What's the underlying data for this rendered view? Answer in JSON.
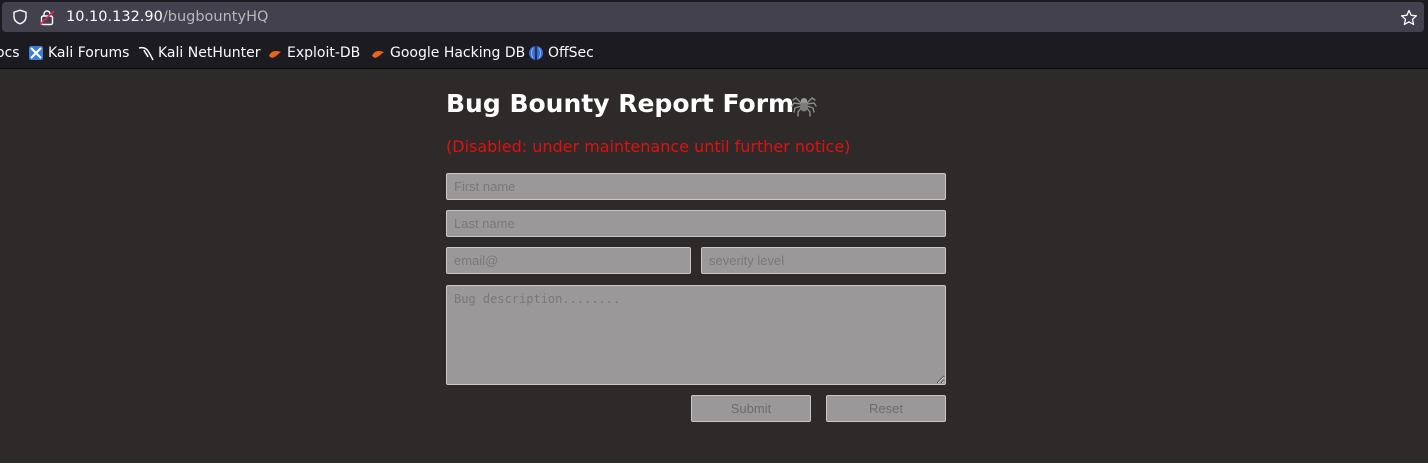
{
  "browser": {
    "url_host": "10.10.132.90",
    "url_path": "/bugbountyHQ",
    "bookmarks": [
      {
        "label": "ocs",
        "icon": "none"
      },
      {
        "label": "Kali Forums",
        "icon": "kali-forums-icon"
      },
      {
        "label": "Kali NetHunter",
        "icon": "kali-dragon-icon"
      },
      {
        "label": "Exploit-DB",
        "icon": "exploit-db-icon"
      },
      {
        "label": "Google Hacking DB",
        "icon": "ghdb-icon"
      },
      {
        "label": "OffSec",
        "icon": "offsec-icon"
      }
    ]
  },
  "page": {
    "title": "Bug Bounty Report Form",
    "title_icon": "spider-icon",
    "notice": "(Disabled: under maintenance until further notice)",
    "notice_color": "#e01010",
    "form": {
      "first_name_placeholder": "First name",
      "last_name_placeholder": "Last name",
      "email_placeholder": "email@",
      "severity_placeholder": "severity level",
      "description_placeholder": "Bug description........",
      "submit_label": "Submit",
      "reset_label": "Reset"
    }
  },
  "colors": {
    "background": "#2e2a29",
    "field_bg": "#9a9898",
    "chrome_bg": "#1c1b22"
  }
}
